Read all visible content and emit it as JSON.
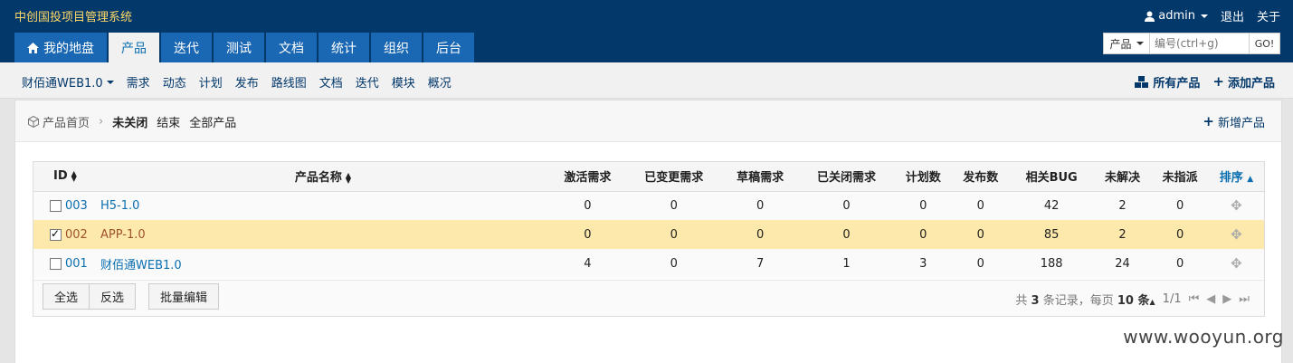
{
  "app": {
    "title": "中创国投项目管理系统",
    "user": "admin",
    "logout": "退出",
    "about": "关于"
  },
  "main_nav": [
    {
      "label": "我的地盘",
      "icon": "home-icon",
      "active": false
    },
    {
      "label": "产品",
      "active": true
    },
    {
      "label": "迭代",
      "active": false
    },
    {
      "label": "测试",
      "active": false
    },
    {
      "label": "文档",
      "active": false
    },
    {
      "label": "统计",
      "active": false
    },
    {
      "label": "组织",
      "active": false
    },
    {
      "label": "后台",
      "active": false
    }
  ],
  "search": {
    "type": "产品",
    "placeholder": "编号(ctrl+g)",
    "go": "GO!"
  },
  "sub_nav": {
    "product": "财佰通WEB1.0",
    "items": [
      "需求",
      "动态",
      "计划",
      "发布",
      "路线图",
      "文档",
      "迭代",
      "模块",
      "概况"
    ],
    "all_products": "所有产品",
    "add_product": "添加产品"
  },
  "breadcrumb": {
    "home": "产品首页",
    "current": "未关闭",
    "closed": "结束",
    "all": "全部产品",
    "new_product": "新增产品"
  },
  "table": {
    "columns": [
      "ID",
      "产品名称",
      "激活需求",
      "已变更需求",
      "草稿需求",
      "已关闭需求",
      "计划数",
      "发布数",
      "相关BUG",
      "未解决",
      "未指派",
      "排序"
    ],
    "rows": [
      {
        "id": "003",
        "name": "H5-1.0",
        "active": "0",
        "changed": "0",
        "draft": "0",
        "closed": "0",
        "plans": "0",
        "releases": "0",
        "bugs": "42",
        "unresolved": "2",
        "unassigned": "0",
        "checked": false
      },
      {
        "id": "002",
        "name": "APP-1.0",
        "active": "0",
        "changed": "0",
        "draft": "0",
        "closed": "0",
        "plans": "0",
        "releases": "0",
        "bugs": "85",
        "unresolved": "2",
        "unassigned": "0",
        "checked": true
      },
      {
        "id": "001",
        "name": "财佰通WEB1.0",
        "active": "4",
        "changed": "0",
        "draft": "7",
        "closed": "1",
        "plans": "3",
        "releases": "0",
        "bugs": "188",
        "unresolved": "24",
        "unassigned": "0",
        "checked": false
      }
    ]
  },
  "footer": {
    "select_all": "全选",
    "invert": "反选",
    "batch_edit": "批量编辑",
    "total_prefix": "共",
    "total": "3",
    "total_suffix": "条记录，每页",
    "per_page": "10",
    "per_page_unit": "条",
    "page": "1/1"
  },
  "watermark": "www.wooyun.org",
  "colors": {
    "header": "#03386b",
    "tab": "#1a67b3",
    "title": "#ffd966",
    "link": "#0b6fb0",
    "checked_row": "#fce9ab"
  }
}
